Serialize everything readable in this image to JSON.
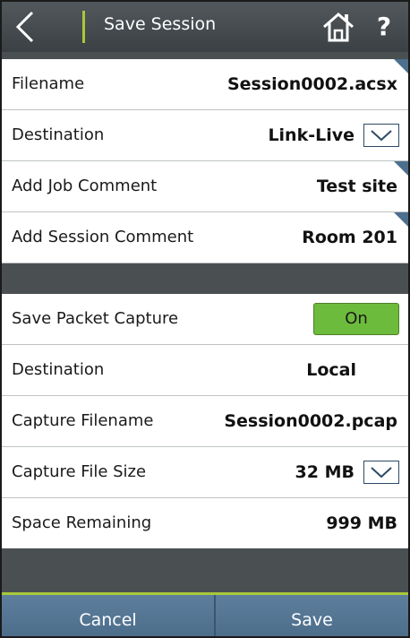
{
  "header": {
    "title": "Save Session",
    "help_label": "?"
  },
  "session": {
    "rows": [
      {
        "label": "Filename",
        "value": "Session0002.acsx"
      },
      {
        "label": "Destination",
        "value": "Link-Live"
      },
      {
        "label": "Add Job Comment",
        "value": "Test site"
      },
      {
        "label": "Add Session Comment",
        "value": "Room 201"
      }
    ]
  },
  "capture": {
    "save_packet_capture": {
      "label": "Save Packet Capture",
      "toggle": "On"
    },
    "destination": {
      "label": "Destination",
      "value": "Local"
    },
    "capture_filename": {
      "label": "Capture Filename",
      "value": "Session0002.pcap"
    },
    "capture_file_size": {
      "label": "Capture File Size",
      "value": "32 MB"
    },
    "space_remaining": {
      "label": "Space Remaining",
      "value": "999 MB"
    }
  },
  "footer": {
    "cancel_label": "Cancel",
    "save_label": "Save"
  },
  "colors": {
    "header_bg": "#464c50",
    "accent_green": "#a8c83a",
    "toggle_on": "#6dbb3c",
    "footer_btn": "#54758f",
    "corner_tab": "#4d6f8e"
  }
}
